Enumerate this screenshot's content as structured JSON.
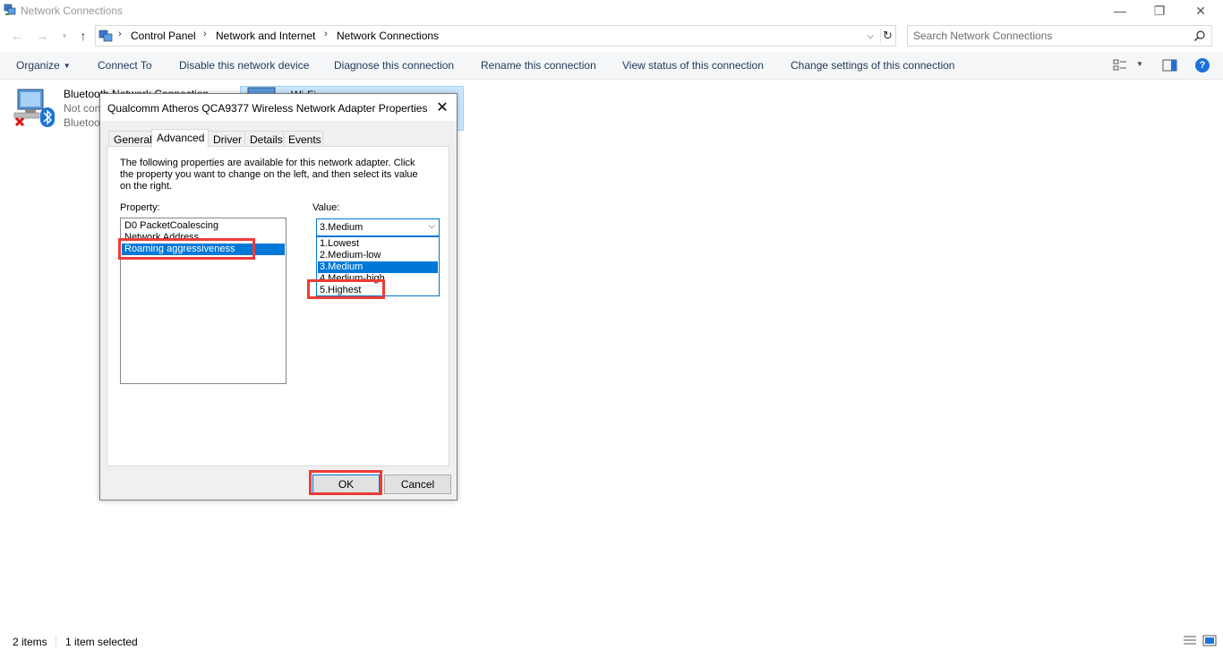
{
  "window": {
    "title": "Network Connections",
    "controls": {
      "minimize": "—",
      "restore": "❐",
      "close": "✕"
    }
  },
  "address": {
    "breadcrumbs": [
      "Control Panel",
      "Network and Internet",
      "Network Connections"
    ],
    "separator": "›",
    "search_placeholder": "Search Network Connections"
  },
  "commands": {
    "organize": "Organize",
    "connect_to": "Connect To",
    "disable": "Disable this network device",
    "diagnose": "Diagnose this connection",
    "rename": "Rename this connection",
    "view_status": "View status of this connection",
    "change_settings": "Change settings of this connection",
    "help": "?"
  },
  "items": [
    {
      "name": "Bluetooth Network Connection",
      "status": "Not connected",
      "device": "Bluetooth Device (Personal Area Network)"
    },
    {
      "name": "Wi-Fi"
    }
  ],
  "dialog": {
    "title": "Qualcomm Atheros QCA9377 Wireless Network Adapter Properties",
    "close": "✕",
    "tabs": [
      "General",
      "Advanced",
      "Driver",
      "Details",
      "Events"
    ],
    "active_tab": "Advanced",
    "description": "The following properties are available for this network adapter. Click the property you want to change on the left, and then select its value on the right.",
    "property_label": "Property:",
    "value_label": "Value:",
    "properties": [
      "D0 PacketCoalescing",
      "Network Address",
      "Roaming aggressiveness"
    ],
    "selected_property": "Roaming aggressiveness",
    "value_selected": "3.Medium",
    "value_options": [
      "1.Lowest",
      "2.Medium-low",
      "3.Medium",
      "4.Medium-high",
      "5.Highest"
    ],
    "ok": "OK",
    "cancel": "Cancel"
  },
  "status": {
    "items_count": "2 items",
    "selected": "1 item selected"
  },
  "colors": {
    "accent": "#0078d7",
    "highlight_annotation": "#ef3b36",
    "command_text": "#1e395b"
  }
}
